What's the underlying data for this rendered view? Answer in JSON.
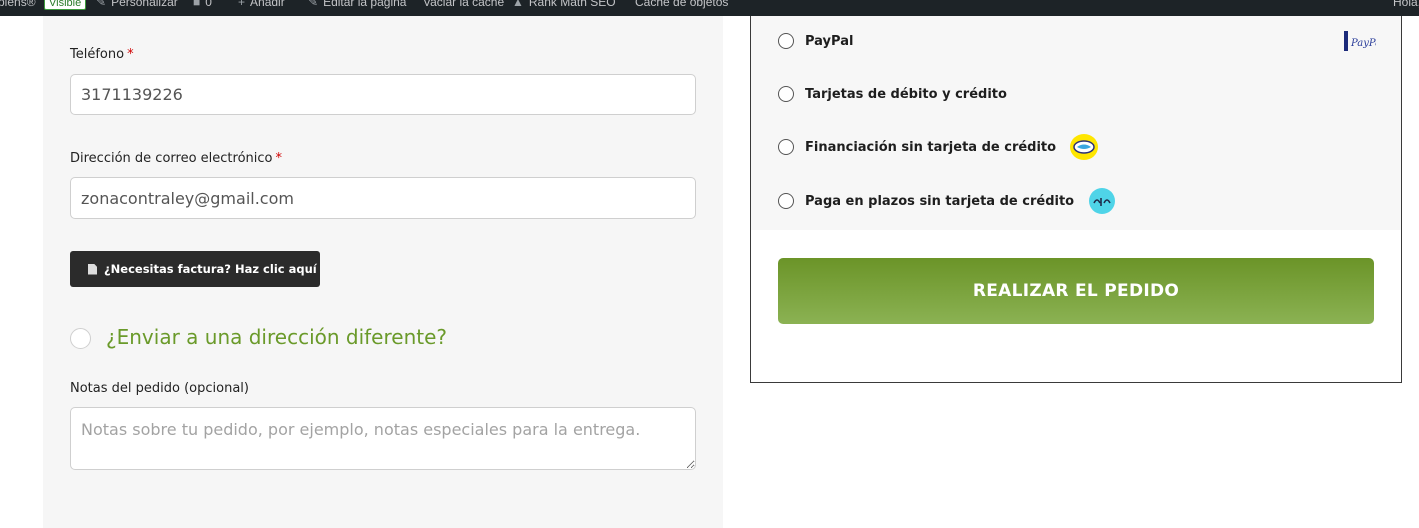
{
  "admin_bar": {
    "site_name": "piens®",
    "visible_badge": "Visible",
    "customize": "Personalizar",
    "comments_count": "0",
    "add_new": "Añadir",
    "edit_page": "Editar la página",
    "clear_cache": "Vaciar la caché",
    "rank_math": "Rank Math SEO",
    "object_cache": "Caché de objetos",
    "greeting": "Hola,"
  },
  "billing": {
    "phone_label": "Teléfono",
    "phone_value": "3171139226",
    "email_label": "Dirección de correo electrónico",
    "email_value": "zonacontraley@gmail.com",
    "required_mark": "*",
    "invoice_button": "¿Necesitas factura? Haz clic aquí",
    "ship_different": "¿Enviar a una dirección diferente?",
    "notes_label": "Notas del pedido (opcional)",
    "notes_placeholder": "Notas sobre tu pedido, por ejemplo, notas especiales para la entrega."
  },
  "payment_methods": [
    {
      "label": "PayPal",
      "logo": "paypal-logo"
    },
    {
      "label": "Tarjetas de débito y crédito",
      "logo": ""
    },
    {
      "label": "Financiación sin tarjeta de crédito",
      "logo": "mercadopago-logo"
    },
    {
      "label": "Paga en plazos sin tarjeta de crédito",
      "logo": "aplazo-logo"
    }
  ],
  "place_order_label": "REALIZAR EL PEDIDO",
  "colors": {
    "accent_green": "#6a9a2a",
    "button_dark": "#2b2b2b",
    "required_red": "#d00000",
    "admin_bar": "#1d2327"
  }
}
